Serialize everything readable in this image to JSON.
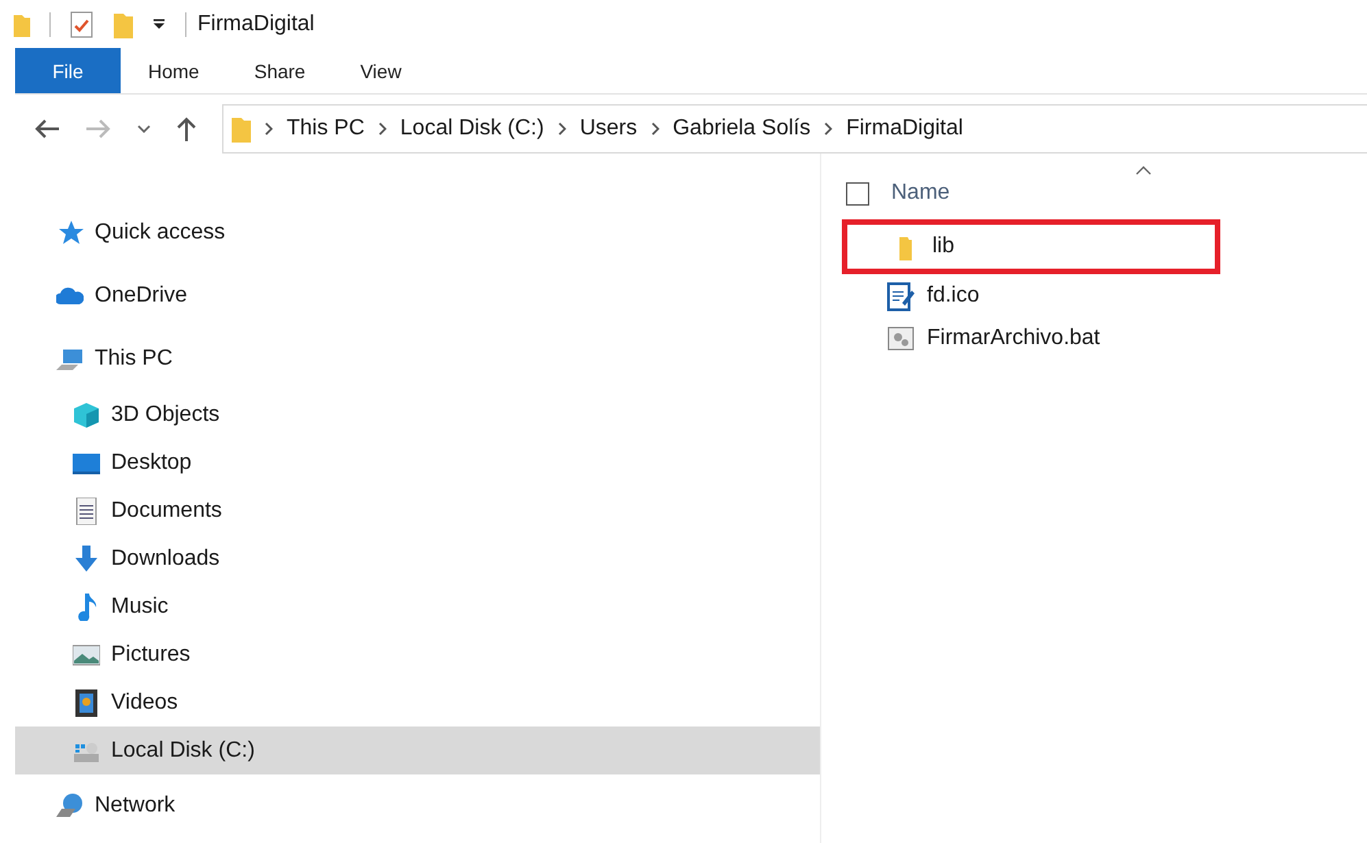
{
  "window": {
    "title": "FirmaDigital"
  },
  "ribbon_tabs": [
    {
      "label": "File",
      "kind": "file"
    },
    {
      "label": "Home",
      "kind": "tab"
    },
    {
      "label": "Share",
      "kind": "tab"
    },
    {
      "label": "View",
      "kind": "tab"
    }
  ],
  "address": {
    "crumbs": [
      "This PC",
      "Local Disk (C:)",
      "Users",
      "Gabriela Solís",
      "FirmaDigital"
    ]
  },
  "sidebar": {
    "items": [
      {
        "label": "Quick access",
        "kind": "star",
        "selected": false
      },
      {
        "label": "OneDrive",
        "kind": "cloud",
        "selected": false
      },
      {
        "label": "This PC",
        "kind": "pc",
        "selected": false,
        "children": [
          {
            "label": "3D Objects",
            "kind": "cube",
            "selected": false
          },
          {
            "label": "Desktop",
            "kind": "desktop",
            "selected": false
          },
          {
            "label": "Documents",
            "kind": "document",
            "selected": false
          },
          {
            "label": "Downloads",
            "kind": "download",
            "selected": false
          },
          {
            "label": "Music",
            "kind": "music",
            "selected": false
          },
          {
            "label": "Pictures",
            "kind": "pictures",
            "selected": false
          },
          {
            "label": "Videos",
            "kind": "videos",
            "selected": false
          },
          {
            "label": "Local Disk (C:)",
            "kind": "disk",
            "selected": true
          }
        ]
      },
      {
        "label": "Network",
        "kind": "network",
        "selected": false
      }
    ]
  },
  "file_list": {
    "column": "Name",
    "checked": false,
    "files": [
      {
        "name": "lib",
        "kind": "folder",
        "highlighted": true
      },
      {
        "name": "fd.ico",
        "kind": "icon-file",
        "highlighted": false
      },
      {
        "name": "FirmarArchivo.bat",
        "kind": "batch",
        "highlighted": false
      }
    ]
  }
}
